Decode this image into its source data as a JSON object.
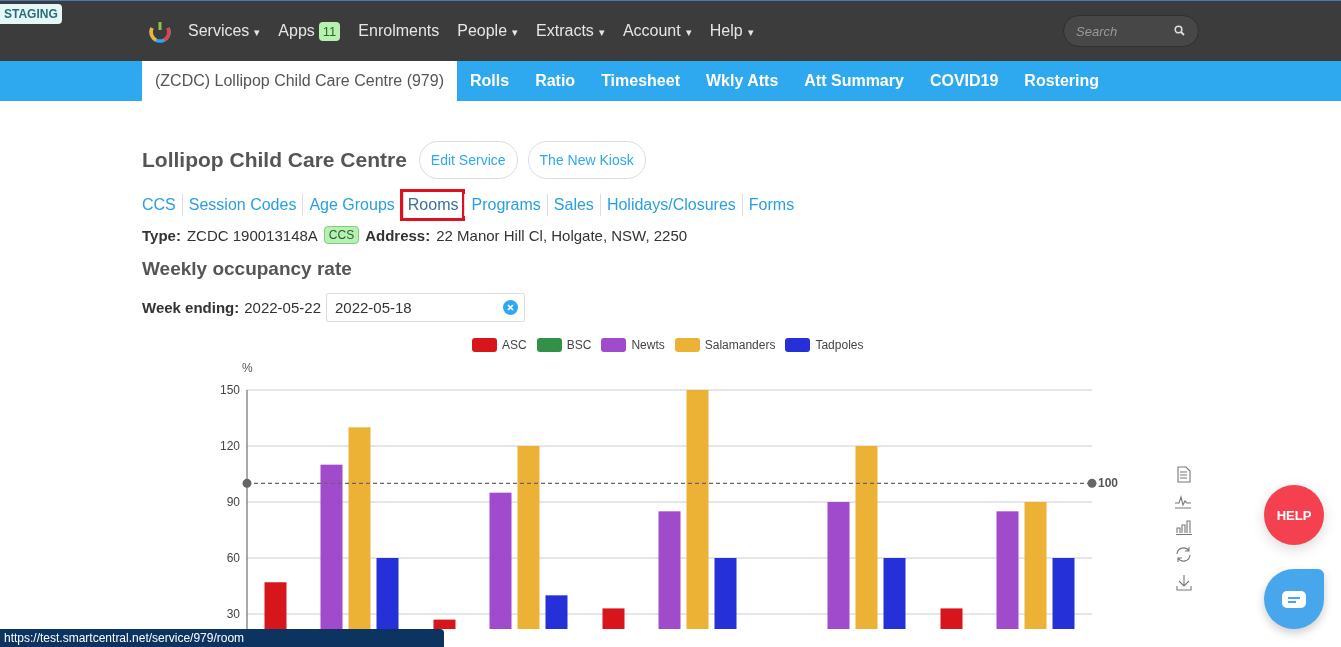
{
  "badge": "STAGING",
  "top_nav": {
    "items": [
      {
        "label": "Services",
        "caret": "▾"
      },
      {
        "label": "Apps",
        "count": "11"
      },
      {
        "label": "Enrolments"
      },
      {
        "label": "People",
        "caret": "▾"
      },
      {
        "label": "Extracts",
        "caret": "▾"
      },
      {
        "label": "Account",
        "caret": "▾"
      },
      {
        "label": "Help",
        "caret": "▾"
      }
    ],
    "search": {
      "placeholder": "Search"
    }
  },
  "sub_nav": [
    {
      "label": "(ZCDC) Lollipop Child Care Centre (979)",
      "selected": true
    },
    {
      "label": "Rolls",
      "selected": false
    },
    {
      "label": "Ratio",
      "selected": false
    },
    {
      "label": "Timesheet",
      "selected": false
    },
    {
      "label": "Wkly Atts",
      "selected": false
    },
    {
      "label": "Att Summary",
      "selected": false
    },
    {
      "label": "COVID19",
      "selected": false
    },
    {
      "label": "Rostering",
      "selected": false
    }
  ],
  "page": {
    "title": "Lollipop Child Care Centre",
    "buttons": [
      "Edit Service",
      "The New Kiosk"
    ],
    "links": [
      {
        "label": "CCS",
        "highlighted": false
      },
      {
        "label": "Session Codes",
        "highlighted": false
      },
      {
        "label": "Age Groups",
        "highlighted": false
      },
      {
        "label": "Rooms",
        "highlighted": true
      },
      {
        "label": "Programs",
        "highlighted": false
      },
      {
        "label": "Sales",
        "highlighted": false
      },
      {
        "label": "Holidays/Closures",
        "highlighted": false
      },
      {
        "label": "Forms",
        "highlighted": false
      }
    ],
    "type_label": "Type:",
    "type_value": "ZCDC 190013148A",
    "type_tag": "CCS",
    "address_label": "Address:",
    "address_value": "22 Manor Hill Cl, Holgate, NSW, 2250",
    "section_title": "Weekly occupancy rate",
    "week_label": "Week ending:",
    "week_value": "2022-05-22",
    "date_field": {
      "value": "2022-05-18"
    }
  },
  "chart": {
    "chart_data": {
      "type": "bar",
      "ylabel": "%",
      "ylim": [
        0,
        150
      ],
      "yticks": [
        30,
        60,
        90,
        120,
        150
      ],
      "series": [
        {
          "name": "ASC",
          "color": "#d7161b",
          "values": [
            47,
            27,
            33,
            null,
            33
          ]
        },
        {
          "name": "BSC",
          "color": "#339147",
          "values": [
            null,
            null,
            null,
            null,
            null
          ]
        },
        {
          "name": "Newts",
          "color": "#a04bcc",
          "values": [
            110,
            95,
            85,
            90,
            85
          ]
        },
        {
          "name": "Salamanders",
          "color": "#ecb236",
          "values": [
            130,
            120,
            150,
            120,
            90
          ]
        },
        {
          "name": "Tadpoles",
          "color": "#2530d8",
          "values": [
            60,
            40,
            60,
            60,
            60
          ]
        }
      ],
      "grid": true,
      "ref_lines": [
        {
          "axis": "y",
          "value": 100,
          "label": "100",
          "color": "#666666"
        }
      ]
    }
  },
  "help_button": "HELP",
  "status_bar": "https://test.smartcentral.net/service/979/room"
}
